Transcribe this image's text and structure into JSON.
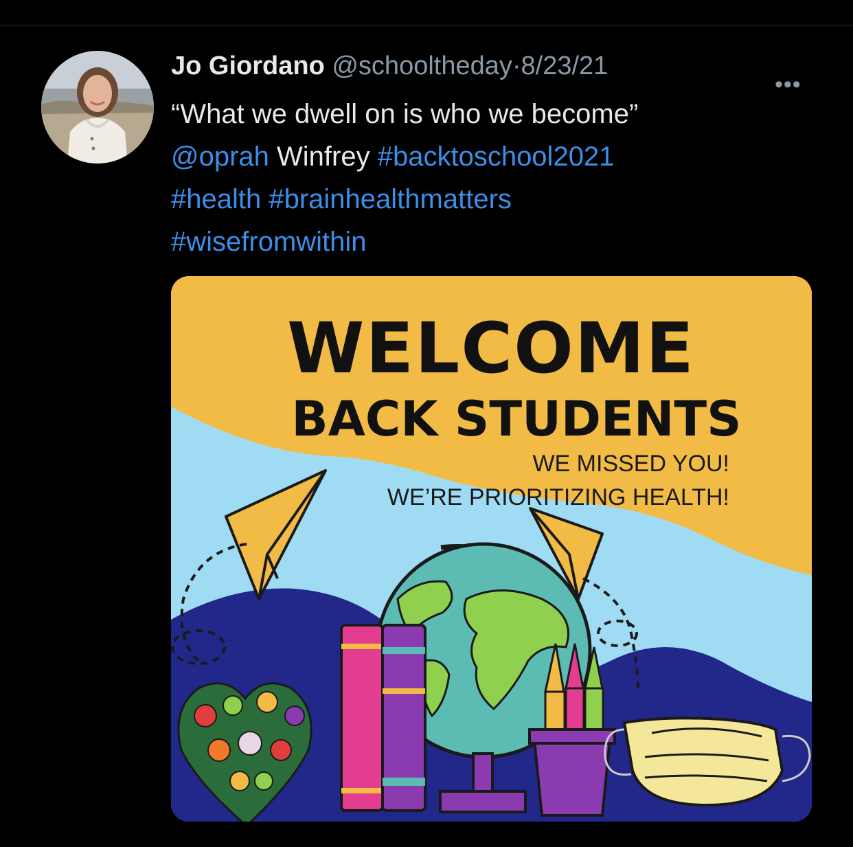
{
  "tweet": {
    "author_name": "Jo Giordano",
    "handle": "@schooltheday",
    "separator": "·",
    "date": "8/23/21",
    "more_icon": "more-horizontal-icon",
    "quote": "“What we dwell on is who we become”",
    "mention": "@oprah",
    "mention_suffix": " Winfrey ",
    "hashtags": [
      "#backtoschool2021",
      "#health",
      "#brainhealthmatters",
      "#wisefromwithin"
    ]
  },
  "poster": {
    "title_line1": "WELCOME",
    "title_line2": "BACK STUDENTS",
    "subline1": "WE MISSED YOU!",
    "subline2": "WE’RE PRIORITIZING HEALTH!"
  },
  "colors": {
    "background": "#000000",
    "text_primary": "#e7e9ea",
    "text_secondary": "#8b98a5",
    "link": "#3b8fe8",
    "poster_yellow": "#f2bb45",
    "poster_light_blue": "#9fdcf4",
    "poster_navy": "#22288a"
  }
}
